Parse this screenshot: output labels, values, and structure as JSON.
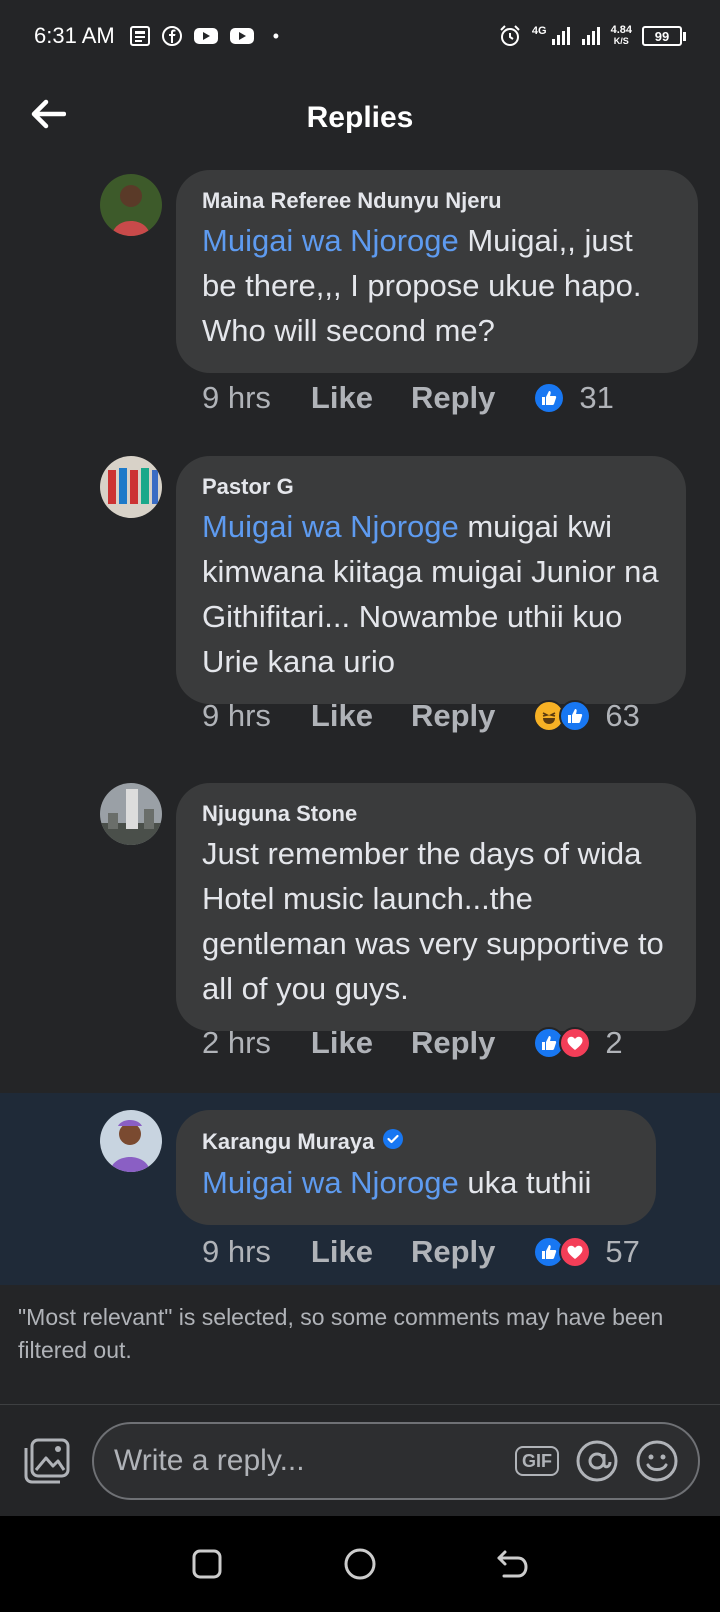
{
  "status_bar": {
    "time": "6:31 AM",
    "network": "4G",
    "speed_value": "4.84",
    "speed_unit": "K/S",
    "battery": "99"
  },
  "header": {
    "title": "Replies"
  },
  "comments": [
    {
      "author": "Maina Referee Ndunyu Njeru",
      "mention": "Muigai wa Njoroge",
      "text": " Muigai,, just be there,,, I propose ukue hapo. Who will second me?",
      "time": "9 hrs",
      "like_label": "Like",
      "reply_label": "Reply",
      "reactions": [
        "like"
      ],
      "reaction_count": "31"
    },
    {
      "author": "Pastor G",
      "mention": "Muigai wa Njoroge",
      "text": " muigai kwi kimwana kiitaga muigai Junior na Githifitari... Nowambe uthii kuo Urie kana urio",
      "time": "9 hrs",
      "like_label": "Like",
      "reply_label": "Reply",
      "reactions": [
        "haha",
        "like"
      ],
      "reaction_count": "63"
    },
    {
      "author": "Njuguna Stone",
      "mention": "",
      "text": "Just remember the days of wida Hotel music launch...the gentleman was very supportive to all of you guys.",
      "time": "2 hrs",
      "like_label": "Like",
      "reply_label": "Reply",
      "reactions": [
        "like",
        "love"
      ],
      "reaction_count": "2"
    },
    {
      "author": "Karangu Muraya",
      "verified": true,
      "mention": "Muigai wa Njoroge",
      "text": " uka tuthii",
      "time": "9 hrs",
      "like_label": "Like",
      "reply_label": "Reply",
      "reactions": [
        "like",
        "love"
      ],
      "reaction_count": "57"
    }
  ],
  "notice": "\"Most relevant\" is selected, so some comments may have been filtered out.",
  "composer": {
    "placeholder": "Write a reply...",
    "gif_label": "GIF"
  },
  "colors": {
    "background": "#242527",
    "bubble": "#3a3b3c",
    "mention": "#5e9bf0",
    "highlight": "#1f2a38",
    "like_blue": "#1877f2",
    "love_red": "#f33e58",
    "haha_yellow": "#f7b125"
  }
}
